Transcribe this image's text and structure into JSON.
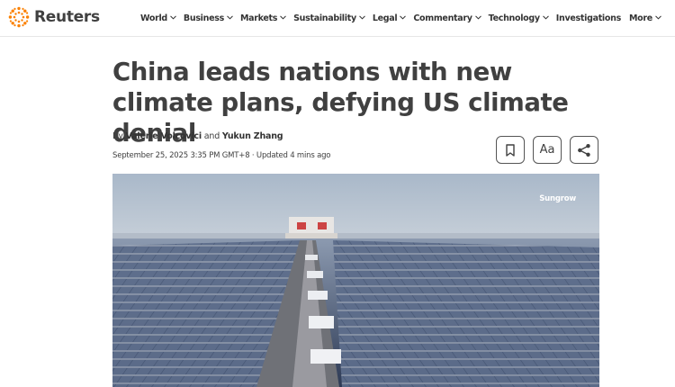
{
  "brand": {
    "name": "Reuters",
    "accent": "#fb8000"
  },
  "nav": {
    "items": [
      {
        "label": "World",
        "dropdown": true
      },
      {
        "label": "Business",
        "dropdown": true
      },
      {
        "label": "Markets",
        "dropdown": true
      },
      {
        "label": "Sustainability",
        "dropdown": true
      },
      {
        "label": "Legal",
        "dropdown": true
      },
      {
        "label": "Commentary",
        "dropdown": true
      },
      {
        "label": "Technology",
        "dropdown": true
      },
      {
        "label": "Investigations",
        "dropdown": false
      },
      {
        "label": "More",
        "dropdown": true
      }
    ]
  },
  "article": {
    "headline": "China leads nations with new climate plans, defying US climate denial",
    "byline_prefix": "By",
    "author1": "Valerie Volcovici",
    "byline_and": "and",
    "author2": "Yukun Zhang",
    "dateline": "September 25, 2025 3:35 PM GMT+8 · Updated 4 mins ago",
    "image_credit": "Sungrow"
  },
  "tools": {
    "bookmark_icon": "bookmark-icon",
    "text_size_label": "Aa",
    "share_icon": "share-icon"
  }
}
